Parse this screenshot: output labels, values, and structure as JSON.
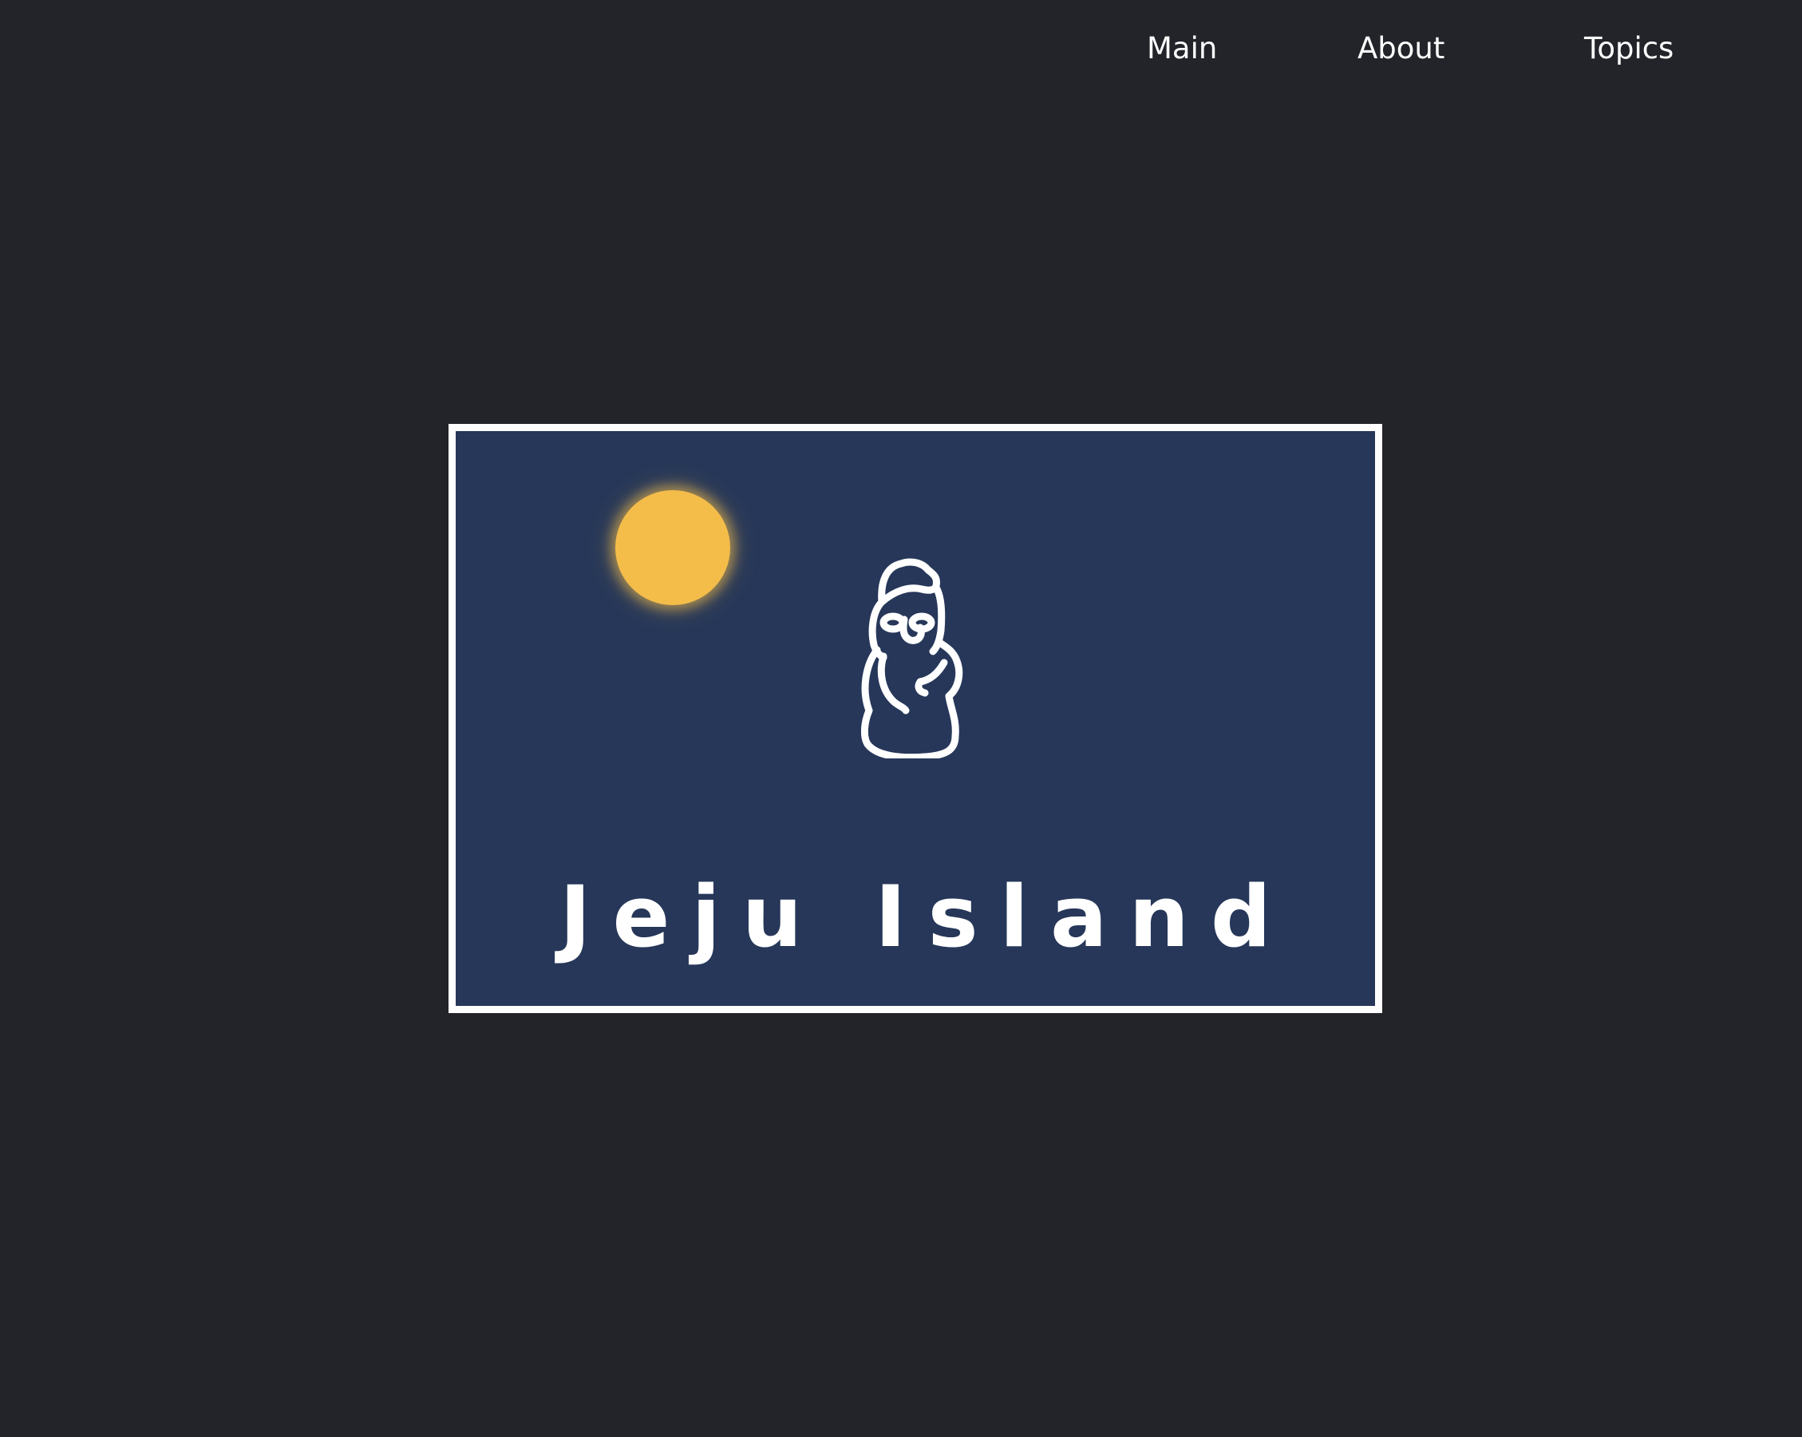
{
  "nav": {
    "items": [
      {
        "label": "Main"
      },
      {
        "label": "About"
      },
      {
        "label": "Topics"
      }
    ]
  },
  "banner": {
    "title": "Jeju Island",
    "icons": {
      "sun": "sun-icon",
      "statue": "dol-hareubang-statue-icon"
    }
  },
  "colors": {
    "page_background": "#222429",
    "banner_background": "#263759",
    "banner_border": "#ffffff",
    "sun": "#f4bd4a",
    "text": "#ffffff"
  }
}
